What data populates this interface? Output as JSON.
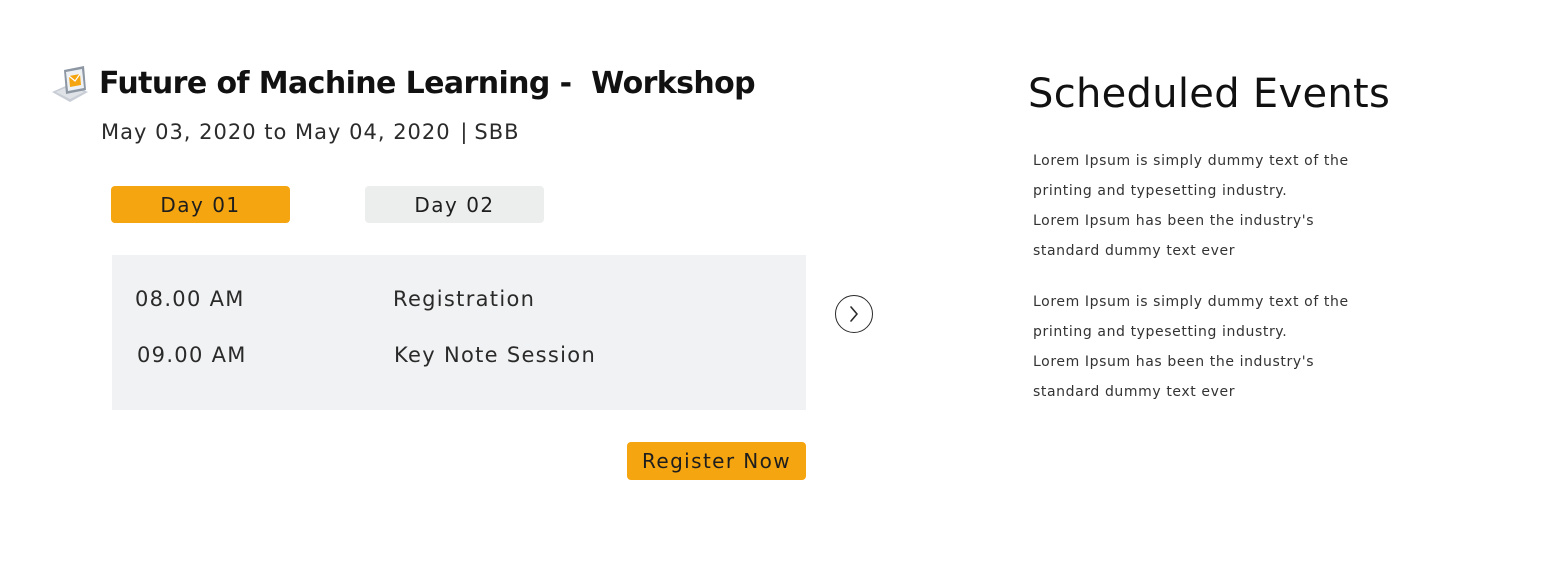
{
  "event": {
    "icon": "laptop-mail-icon",
    "title": "Future of Machine Learning -  Workshop",
    "date_range": "May 03, 2020 to May 04, 2020",
    "separator": "|",
    "location": "SBB",
    "tabs": [
      {
        "label": "Day 01",
        "active": true
      },
      {
        "label": "Day 02",
        "active": false
      }
    ],
    "schedule": [
      {
        "time": "08.00 AM",
        "session": "Registration"
      },
      {
        "time": "09.00 AM",
        "session": "Key Note Session"
      }
    ],
    "next_icon": "chevron-right-icon",
    "register_label": "Register Now"
  },
  "scheduled_events": {
    "title": "Scheduled Events",
    "paragraphs": [
      [
        "Lorem Ipsum is simply dummy text of the",
        "printing and typesetting industry.",
        "Lorem Ipsum has been the industry's",
        "standard dummy text ever"
      ],
      [
        "Lorem Ipsum is simply dummy text of the",
        "printing and typesetting industry.",
        "Lorem Ipsum has been the industry's",
        "standard dummy text ever"
      ]
    ]
  },
  "colors": {
    "accent": "#f5a50f",
    "inactive_tab": "#eceded",
    "schedule_bg": "#f1f2f3"
  }
}
